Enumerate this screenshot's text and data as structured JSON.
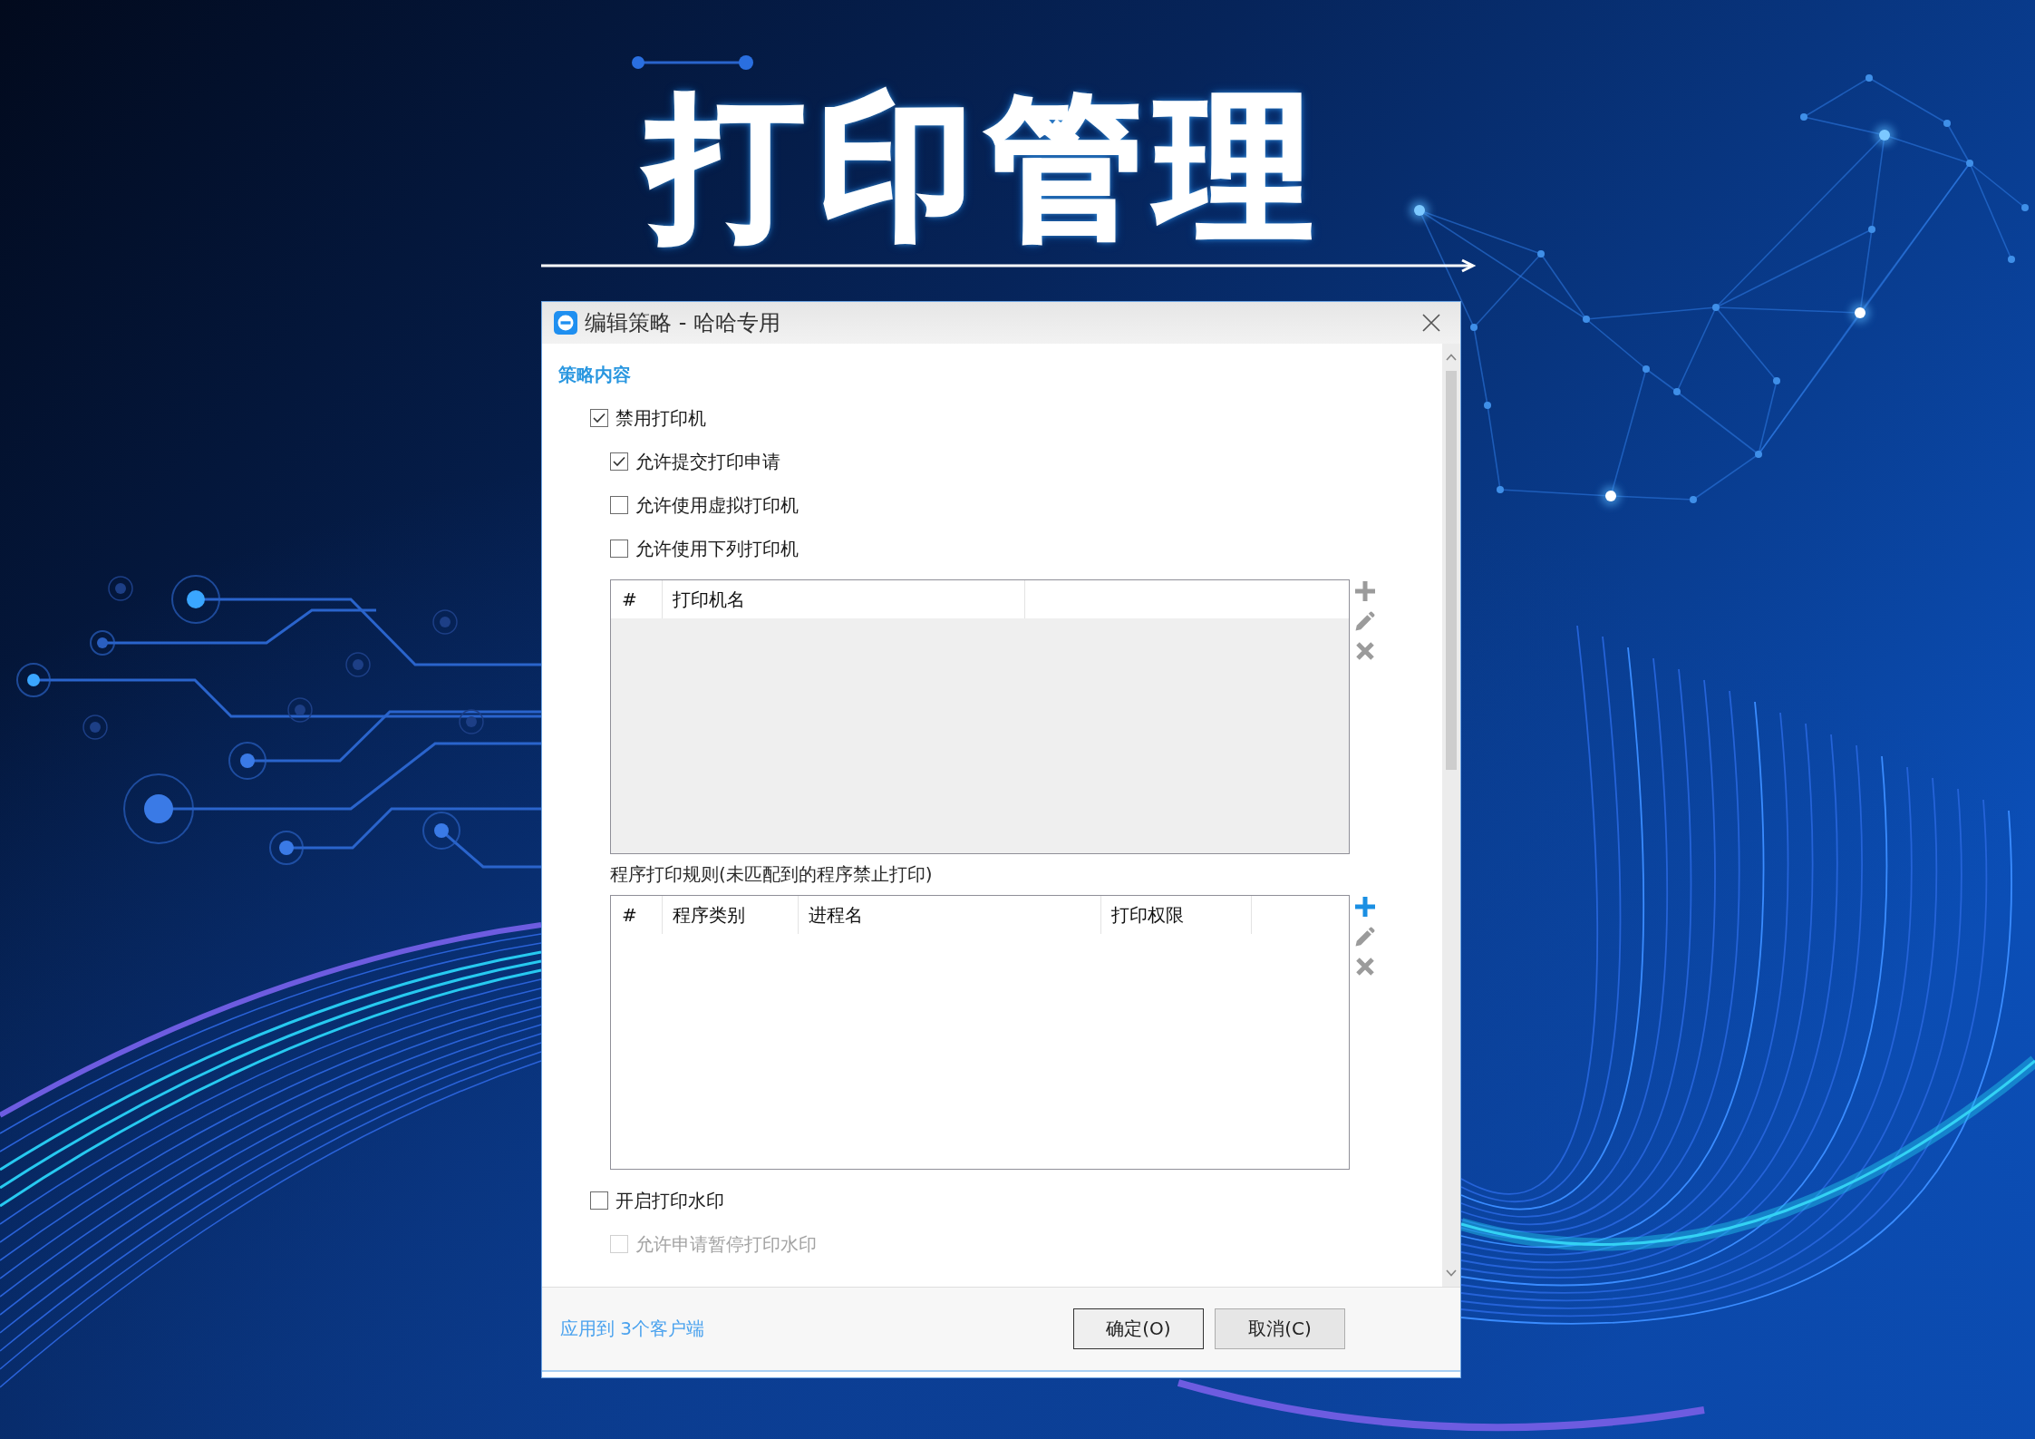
{
  "banner": {
    "title": "打印管理"
  },
  "dialog": {
    "title": "编辑策略 - 哈哈专用",
    "section_title": "策略内容",
    "content": [
      {
        "kind": "checkbox",
        "label": "禁用打印机",
        "checked": true,
        "disabled": false,
        "children": [
          {
            "kind": "checkbox",
            "label": "允许提交打印申请",
            "checked": true,
            "disabled": false
          },
          {
            "kind": "checkbox",
            "label": "允许使用虚拟打印机",
            "checked": false,
            "disabled": false
          },
          {
            "kind": "checkbox",
            "label": "允许使用下列打印机",
            "checked": false,
            "disabled": false
          },
          {
            "kind": "table",
            "disabled": true,
            "columns": [
              "#",
              "打印机名"
            ],
            "tools": [
              {
                "kind": "add",
                "disabled": true
              },
              {
                "kind": "edit",
                "disabled": true
              },
              {
                "kind": "delete",
                "disabled": true
              }
            ]
          },
          {
            "kind": "caption",
            "text": "程序打印规则(未匹配到的程序禁止打印)"
          },
          {
            "kind": "table",
            "disabled": false,
            "columns": [
              "#",
              "程序类别",
              "进程名",
              "打印权限"
            ],
            "tools": [
              {
                "kind": "add",
                "disabled": false
              },
              {
                "kind": "edit",
                "disabled": true
              },
              {
                "kind": "delete",
                "disabled": true
              }
            ]
          }
        ]
      },
      {
        "kind": "checkbox",
        "label": "开启打印水印",
        "checked": false,
        "disabled": false,
        "children": [
          {
            "kind": "checkbox",
            "label": "允许申请暂停打印水印",
            "checked": false,
            "disabled": true
          }
        ]
      }
    ],
    "footer": {
      "apply_link": "应用到 3个客户端",
      "buttons": [
        {
          "kind": "ok",
          "label": "确定(O)"
        },
        {
          "kind": "cancel",
          "label": "取消(C)"
        }
      ]
    }
  }
}
